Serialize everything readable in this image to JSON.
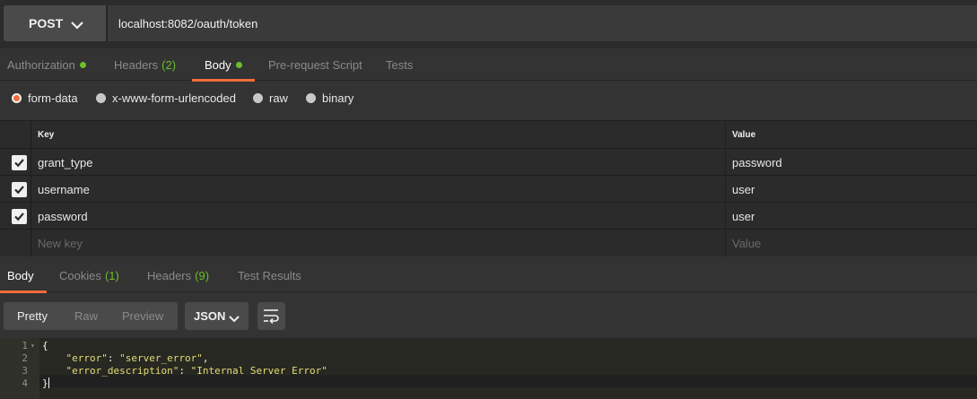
{
  "request": {
    "method": "POST",
    "url": "localhost:8082/oauth/token"
  },
  "request_tabs": [
    {
      "label": "Authorization",
      "count": "",
      "dot": true
    },
    {
      "label": "Headers",
      "count": "(2)",
      "dot": false
    },
    {
      "label": "Body",
      "count": "",
      "dot": true
    },
    {
      "label": "Pre-request Script",
      "count": "",
      "dot": false
    },
    {
      "label": "Tests",
      "count": "",
      "dot": false
    }
  ],
  "active_request_tab": "Body",
  "body_types": [
    {
      "label": "form-data",
      "checked": true
    },
    {
      "label": "x-www-form-urlencoded",
      "checked": false
    },
    {
      "label": "raw",
      "checked": false
    },
    {
      "label": "binary",
      "checked": false
    }
  ],
  "kv_table": {
    "key_header": "Key",
    "value_header": "Value",
    "rows": [
      {
        "key": "grant_type",
        "value": "password",
        "checked": true
      },
      {
        "key": "username",
        "value": "user",
        "checked": true
      },
      {
        "key": "password",
        "value": "user",
        "checked": true
      }
    ],
    "new_key_placeholder": "New key",
    "new_value_placeholder": "Value"
  },
  "response_tabs": [
    {
      "label": "Body",
      "count": ""
    },
    {
      "label": "Cookies",
      "count": "(1)"
    },
    {
      "label": "Headers",
      "count": "(9)"
    },
    {
      "label": "Test Results",
      "count": ""
    }
  ],
  "active_response_tab": "Body",
  "view_modes": [
    "Pretty",
    "Raw",
    "Preview"
  ],
  "active_view_mode": "Pretty",
  "format": "JSON",
  "code": {
    "line_numbers": [
      "1",
      "2",
      "3",
      "4"
    ],
    "open_brace": "{",
    "key1": "\"error\"",
    "val1": "\"server_error\"",
    "key2": "\"error_description\"",
    "val2": "\"Internal Server Error\"",
    "close_brace": "}"
  },
  "colors": {
    "accent": "#f26b3a",
    "count_green": "#6abf2a",
    "string_yellow": "#e6db74"
  },
  "icons": {
    "method_dropdown": "chevron-down-icon",
    "format_dropdown": "chevron-down-icon",
    "wrap": "wrap-lines-icon",
    "checkbox": "checkmark-icon",
    "fold": "fold-arrow-icon"
  }
}
